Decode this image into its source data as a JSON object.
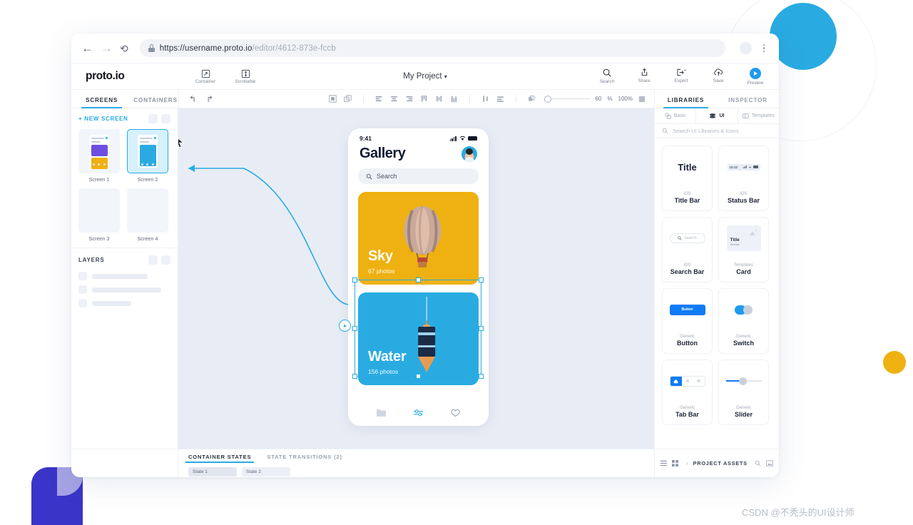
{
  "browser": {
    "url_main": "https://username.proto.io",
    "url_dim": "/editor/4612-873e-fccb",
    "back_icon": "arrow-left-icon",
    "forward_icon": "arrow-right-icon",
    "reload_icon": "reload-icon",
    "lock_icon": "lock-icon",
    "menu_icon": "kebab-menu-icon"
  },
  "app": {
    "logo": "proto.io",
    "project_name": "My Project",
    "project_caret": "▾",
    "header_tools": [
      {
        "label": "Container",
        "icon": "container-icon"
      },
      {
        "label": "Scrollable",
        "icon": "scrollable-icon"
      }
    ],
    "header_right": [
      {
        "label": "Search",
        "icon": "search-icon"
      },
      {
        "label": "Share",
        "icon": "share-icon"
      },
      {
        "label": "Export",
        "icon": "export-icon"
      },
      {
        "label": "Save",
        "icon": "cloud-save-icon"
      },
      {
        "label": "Preview",
        "icon": "play-icon"
      }
    ]
  },
  "toolbar": {
    "left_tabs": [
      {
        "label": "SCREENS",
        "active": true
      },
      {
        "label": "CONTAINERS",
        "active": false
      }
    ],
    "undo_icon": "undo-icon",
    "redo_icon": "redo-icon",
    "zoom_value": "60",
    "zoom_unit": "%",
    "zoom_fit": "100%",
    "right_tabs": [
      {
        "label": "LIBRARIES",
        "active": true
      },
      {
        "label": "INSPECTOR",
        "active": false
      }
    ]
  },
  "left_panel": {
    "new_screen_label": "+ NEW SCREEN",
    "screens": [
      {
        "label": "Screen 1",
        "selected": false,
        "kind": "gallery"
      },
      {
        "label": "Screen 2",
        "selected": true,
        "kind": "water"
      },
      {
        "label": "Screen 3",
        "selected": false,
        "kind": "empty"
      },
      {
        "label": "Screen 4",
        "selected": false,
        "kind": "empty"
      }
    ],
    "layers_title": "LAYERS",
    "layer_widths": [
      78,
      97,
      55
    ]
  },
  "phone": {
    "status_time": "9:41",
    "title": "Gallery",
    "search_placeholder": "Search",
    "search_icon": "search-icon",
    "cards": [
      {
        "title": "Sky",
        "subtitle": "67 photos",
        "color": "#EFB111",
        "image": "hot-air-balloon"
      },
      {
        "title": "Water",
        "subtitle": "156 photos",
        "color": "#29ABE2",
        "image": "sailboat"
      }
    ],
    "tabbar_icons": [
      "folder-icon",
      "sliders-icon",
      "heart-icon"
    ]
  },
  "bottom": {
    "tabs": [
      {
        "label": "CONTAINER STATES",
        "active": true
      },
      {
        "label": "STATE TRANSITIONS (2)",
        "active": false
      }
    ],
    "states": [
      {
        "label": "State 1",
        "selected": true
      },
      {
        "label": "State 2",
        "selected": false
      }
    ],
    "project_assets_label": "PROJECT ASSETS",
    "expand_icon": "chevron-right-icon",
    "list_view_icon": "list-view-icon",
    "grid_view_icon": "grid-view-icon",
    "assets_search_icon": "search-icon",
    "assets_import_icon": "import-icon"
  },
  "right_panel": {
    "tabs": [
      {
        "label": "Basic",
        "icon": "shapes-icon",
        "active": false
      },
      {
        "label": "UI",
        "icon": "layers-icon",
        "active": true
      },
      {
        "label": "Templates",
        "icon": "templates-icon",
        "active": false
      }
    ],
    "search_placeholder": "Search UI Libraries & Icons",
    "search_icon": "search-icon",
    "components": [
      {
        "category": "iOS",
        "name": "Title Bar",
        "preview": "title"
      },
      {
        "category": "iOS",
        "name": "Status Bar",
        "preview": "statusbar",
        "time": "10:22"
      },
      {
        "category": "iOS",
        "name": "Search Bar",
        "preview": "searchbar",
        "placeholder": "Search"
      },
      {
        "category": "Templates",
        "name": "Card",
        "preview": "card",
        "card_title": "Title",
        "card_sub": "Subtitle"
      },
      {
        "category": "Generic",
        "name": "Button",
        "preview": "button",
        "button_label": "Button"
      },
      {
        "category": "Generic",
        "name": "Switch",
        "preview": "switch"
      },
      {
        "category": "Generic",
        "name": "Tab Bar",
        "preview": "tabbar"
      },
      {
        "category": "Generic",
        "name": "Slider",
        "preview": "slider"
      }
    ]
  },
  "watermark": "CSDN @不秃头的UI设计师",
  "colors": {
    "accent": "#29ABE2",
    "yellow": "#EFB111",
    "purple": "#3A34C8",
    "blue_button": "#0F7BF4"
  }
}
